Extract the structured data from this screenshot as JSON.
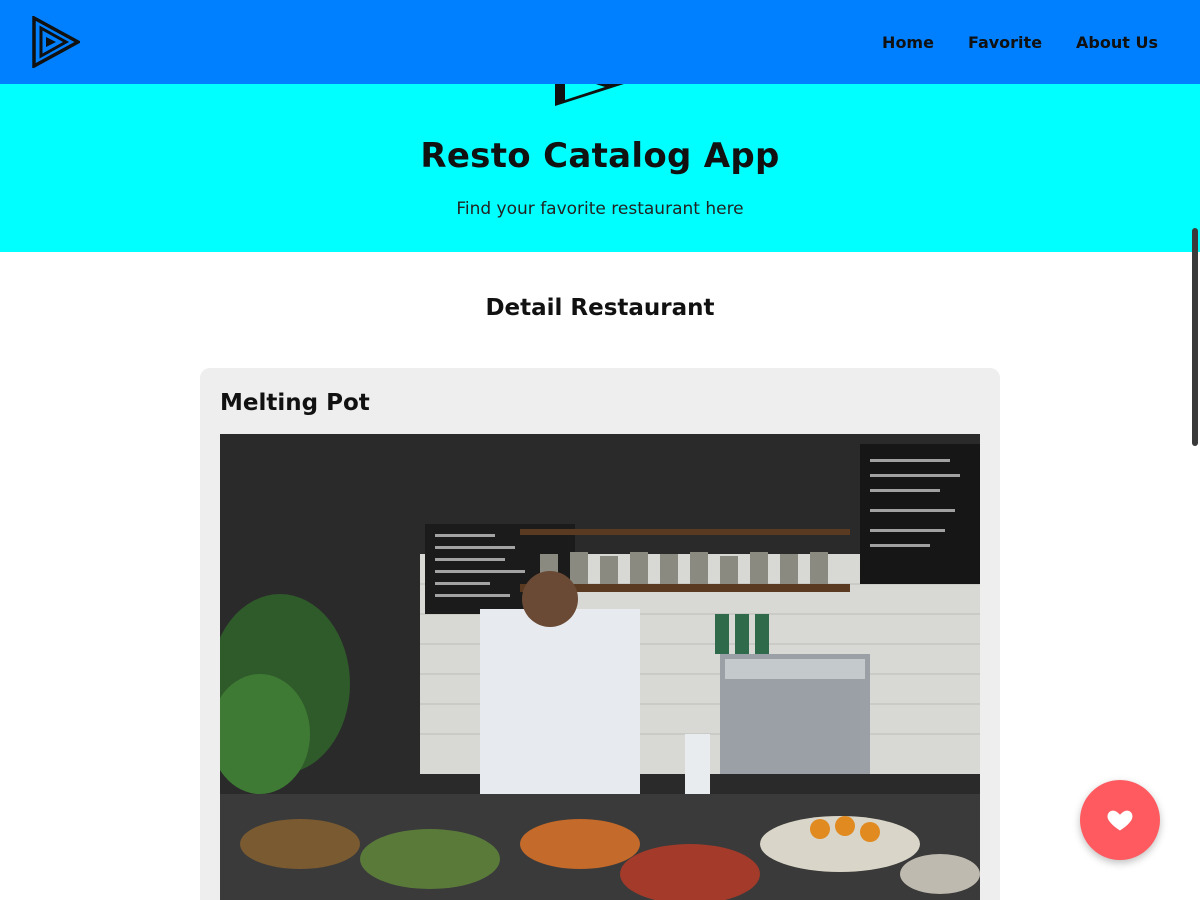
{
  "navbar": {
    "logo_icon": "play-triangle-logo-icon",
    "links": [
      {
        "label": "Home"
      },
      {
        "label": "Favorite"
      },
      {
        "label": "About Us"
      }
    ]
  },
  "hero": {
    "title": "Resto Catalog App",
    "subtitle": "Find your favorite restaurant here"
  },
  "main": {
    "section_title": "Detail Restaurant",
    "restaurant": {
      "name": "Melting Pot"
    }
  },
  "fab": {
    "icon": "heart-icon"
  },
  "colors": {
    "navbar": "#0080ff",
    "hero": "#00ffff",
    "card": "#eeeeee",
    "fab": "#ff5a5f"
  }
}
